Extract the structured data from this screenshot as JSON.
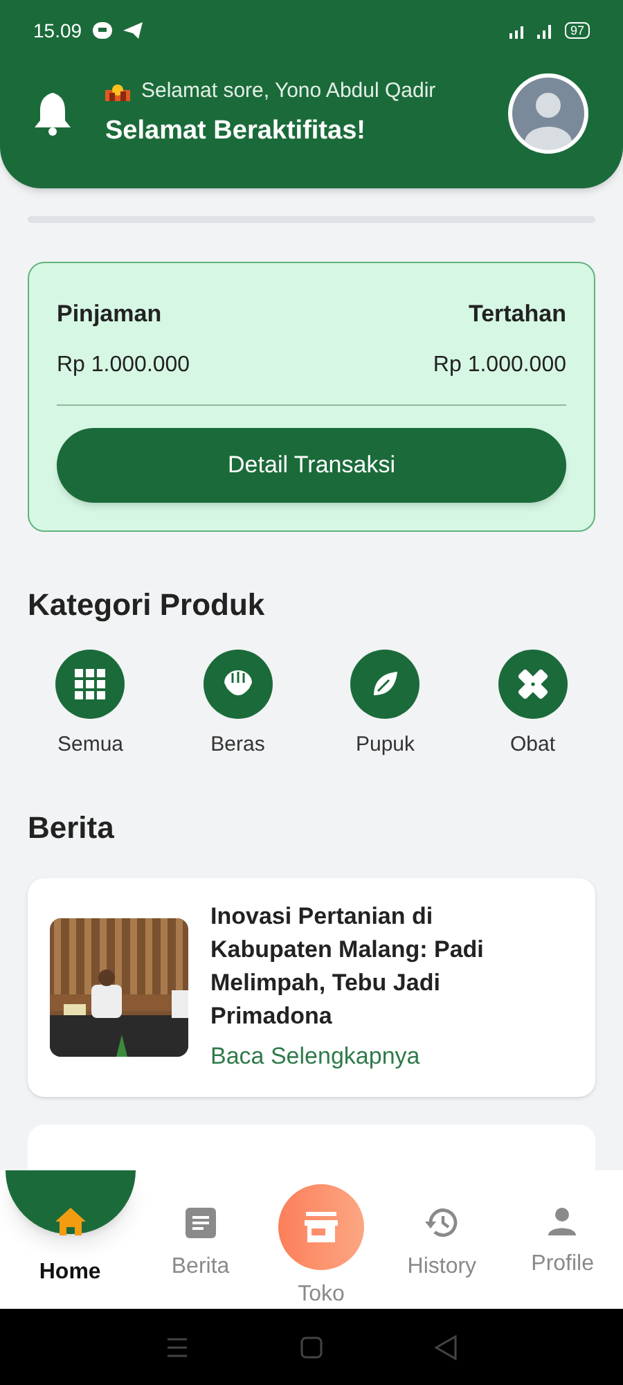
{
  "status_bar": {
    "time": "15.09",
    "battery": "97"
  },
  "header": {
    "greeting": "Selamat sore, Yono Abdul Qadir",
    "title": "Selamat Beraktifitas!"
  },
  "balance_card": {
    "left_label": "Pinjaman",
    "left_value": "Rp 1.000.000",
    "right_label": "Tertahan",
    "right_value": "Rp 1.000.000",
    "button": "Detail Transaksi"
  },
  "categories": {
    "title": "Kategori Produk",
    "items": [
      {
        "label": "Semua",
        "kind": "grid"
      },
      {
        "label": "Beras",
        "kind": "rice"
      },
      {
        "label": "Pupuk",
        "kind": "leaf"
      },
      {
        "label": "Obat",
        "kind": "bandage"
      }
    ]
  },
  "news": {
    "title": "Berita",
    "items": [
      {
        "title": "Inovasi Pertanian di Kabupaten Malang: Padi Melimpah, Tebu Jadi Primadona",
        "link": "Baca Selengkapnya"
      }
    ],
    "more_below": true
  },
  "bottom_nav": [
    {
      "label": "Home",
      "kind": "home",
      "selected": true
    },
    {
      "label": "Berita",
      "kind": "news",
      "selected": false
    },
    {
      "label": "Toko",
      "kind": "store",
      "selected": false
    },
    {
      "label": "History",
      "kind": "history",
      "selected": false
    },
    {
      "label": "Profile",
      "kind": "profile",
      "selected": false
    }
  ]
}
